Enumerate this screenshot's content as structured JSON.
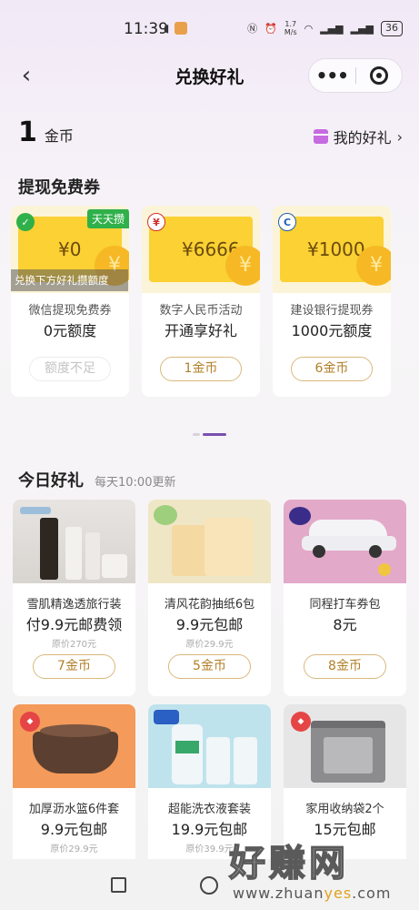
{
  "status_bar": {
    "time": "11:39",
    "net_speed": "1.7\nM/s",
    "battery": "36"
  },
  "nav": {
    "title": "兑换好礼",
    "more_label": "•••"
  },
  "coins": {
    "amount": "1",
    "unit": "金币",
    "my_gifts_label": "我的好礼"
  },
  "vouchers_section": {
    "title": "提现免费券",
    "items": [
      {
        "amount": "¥0",
        "tag": "天天攒",
        "overlay": "兑换下方好礼攒额度",
        "subtitle": "微信提现免费券",
        "main": "0元额度",
        "button": "额度不足",
        "disabled": true
      },
      {
        "amount": "¥6666",
        "subtitle": "数字人民币活动",
        "main": "开通享好礼",
        "button": "1金币",
        "disabled": false
      },
      {
        "amount": "¥1000",
        "subtitle": "建设银行提现券",
        "main": "1000元额度",
        "button": "6金币",
        "disabled": false
      }
    ]
  },
  "today_section": {
    "title": "今日好礼",
    "subtitle": "每天10:00更新",
    "items": [
      {
        "name": "雪肌精逸透旅行装",
        "price": "付9.9元邮费领",
        "original": "原价270元",
        "button": "7金币"
      },
      {
        "name": "清风花韵抽纸6包",
        "price": "9.9元包邮",
        "original": "原价29.9元",
        "button": "5金币"
      },
      {
        "name": "同程打车券包",
        "price": "8元",
        "original": "",
        "button": "8金币"
      },
      {
        "name": "加厚沥水篮6件套",
        "price": "9.9元包邮",
        "original": "原价29.9元",
        "button": ""
      },
      {
        "name": "超能洗衣液套装",
        "price": "19.9元包邮",
        "original": "原价39.9元",
        "button": ""
      },
      {
        "name": "家用收纳袋2个",
        "price": "15元包邮",
        "original": "",
        "button": ""
      }
    ]
  },
  "watermark": {
    "big": "好赚网",
    "small_a": "www.zhuan",
    "small_b": "yes",
    "small_c": ".com"
  },
  "colors": {
    "accent_gold": "#b08028",
    "voucher_yellow": "#fbd133",
    "pager_active": "#7a4fb0"
  }
}
